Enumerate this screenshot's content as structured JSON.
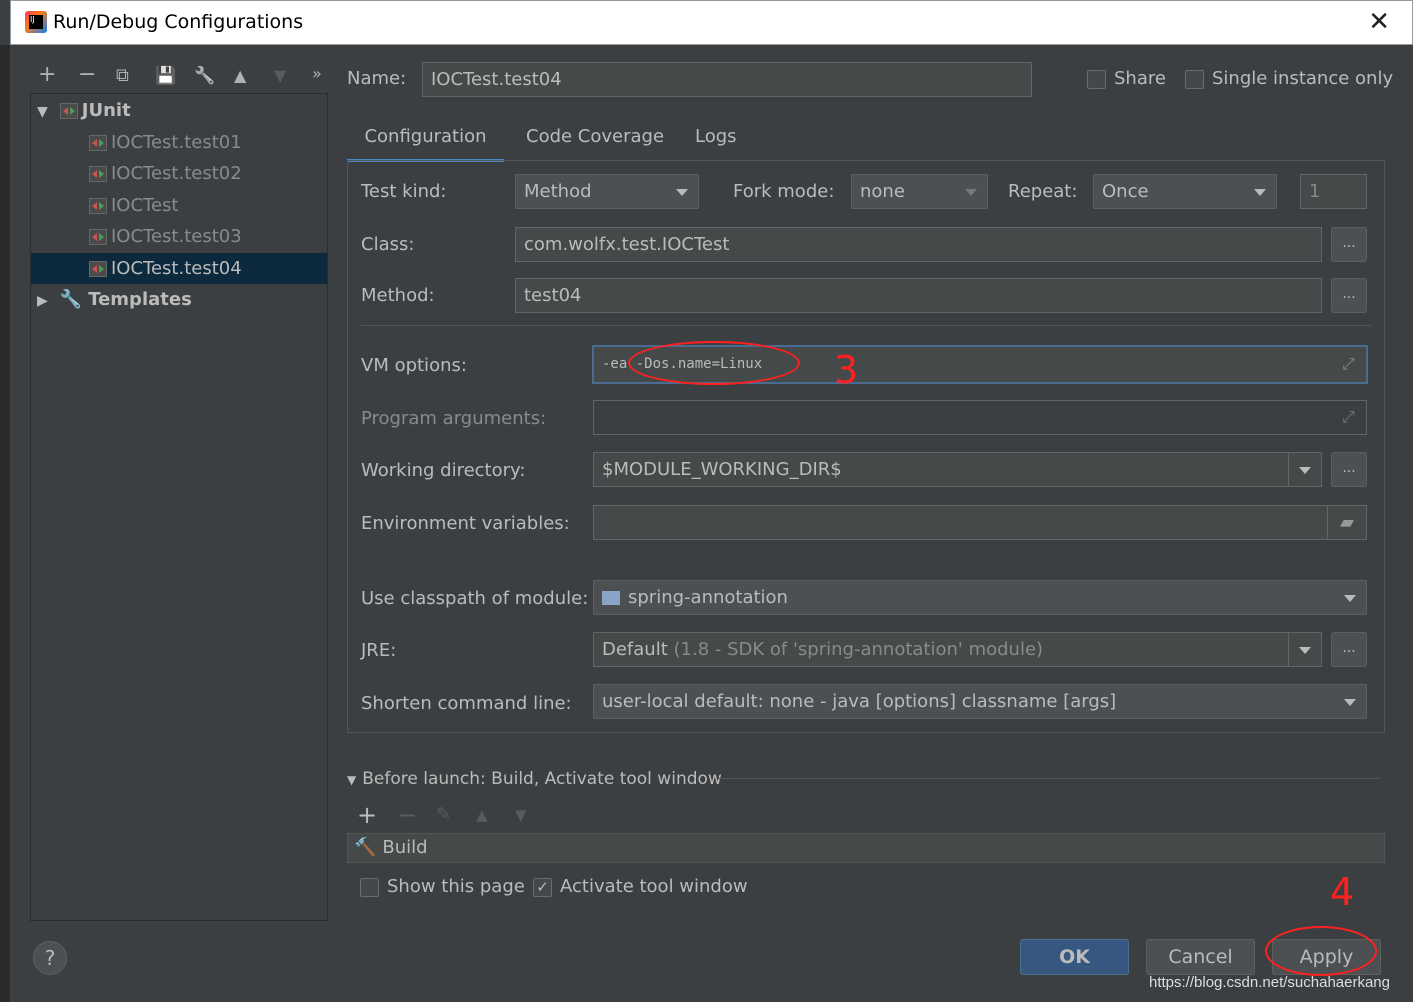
{
  "window": {
    "title": "Run/Debug Configurations",
    "close": "✕"
  },
  "toolbar": {
    "add": "+",
    "remove": "−",
    "copy": "⧉",
    "save": "💾",
    "wrench": "🔧",
    "up": "▲",
    "down": "▼",
    "more": "»"
  },
  "tree": {
    "root": "JUnit",
    "items": [
      "IOCTest.test01",
      "IOCTest.test02",
      "IOCTest",
      "IOCTest.test03",
      "IOCTest.test04"
    ],
    "selected": "IOCTest.test04",
    "templates": "Templates"
  },
  "header": {
    "name_label": "Name:",
    "name_value": "IOCTest.test04",
    "share": "Share",
    "share_checked": false,
    "single_instance": "Single instance only",
    "single_checked": false
  },
  "tabs": [
    {
      "label": "Configuration",
      "active": true
    },
    {
      "label": "Code Coverage"
    },
    {
      "label": "Logs"
    }
  ],
  "form": {
    "test_kind_label": "Test kind:",
    "test_kind": "Method",
    "fork_mode_label": "Fork mode:",
    "fork_mode": "none",
    "repeat_label": "Repeat:",
    "repeat": "Once",
    "repeat_count": "1",
    "class_label": "Class:",
    "class_value": "com.wolfx.test.IOCTest",
    "method_label": "Method:",
    "method_value": "test04",
    "vm_label": "VM options:",
    "vm_value": "-ea -Dos.name=Linux",
    "program_label": "Program arguments:",
    "program_value": "",
    "workdir_label": "Working directory:",
    "workdir_value": "$MODULE_WORKING_DIR$",
    "env_label": "Environment variables:",
    "env_value": "",
    "module_label": "Use classpath of module:",
    "module_value": "spring-annotation",
    "jre_label": "JRE:",
    "jre_value": "Default",
    "jre_hint": "(1.8 - SDK of 'spring-annotation' module)",
    "shorten_label": "Shorten command line:",
    "shorten_value": "user-local default: none - java [options] classname [args]",
    "browse": "..."
  },
  "before_launch": {
    "title": "Before launch: Build, Activate tool window",
    "items": [
      "Build"
    ],
    "show_page": "Show this page",
    "show_checked": false,
    "activate": "Activate tool window",
    "activate_checked": true
  },
  "annotations": {
    "step3": "3",
    "step4": "4"
  },
  "buttons": {
    "ok": "OK",
    "cancel": "Cancel",
    "apply": "Apply",
    "help": "?"
  },
  "watermark": "https://blog.csdn.net/suchahaerkang"
}
